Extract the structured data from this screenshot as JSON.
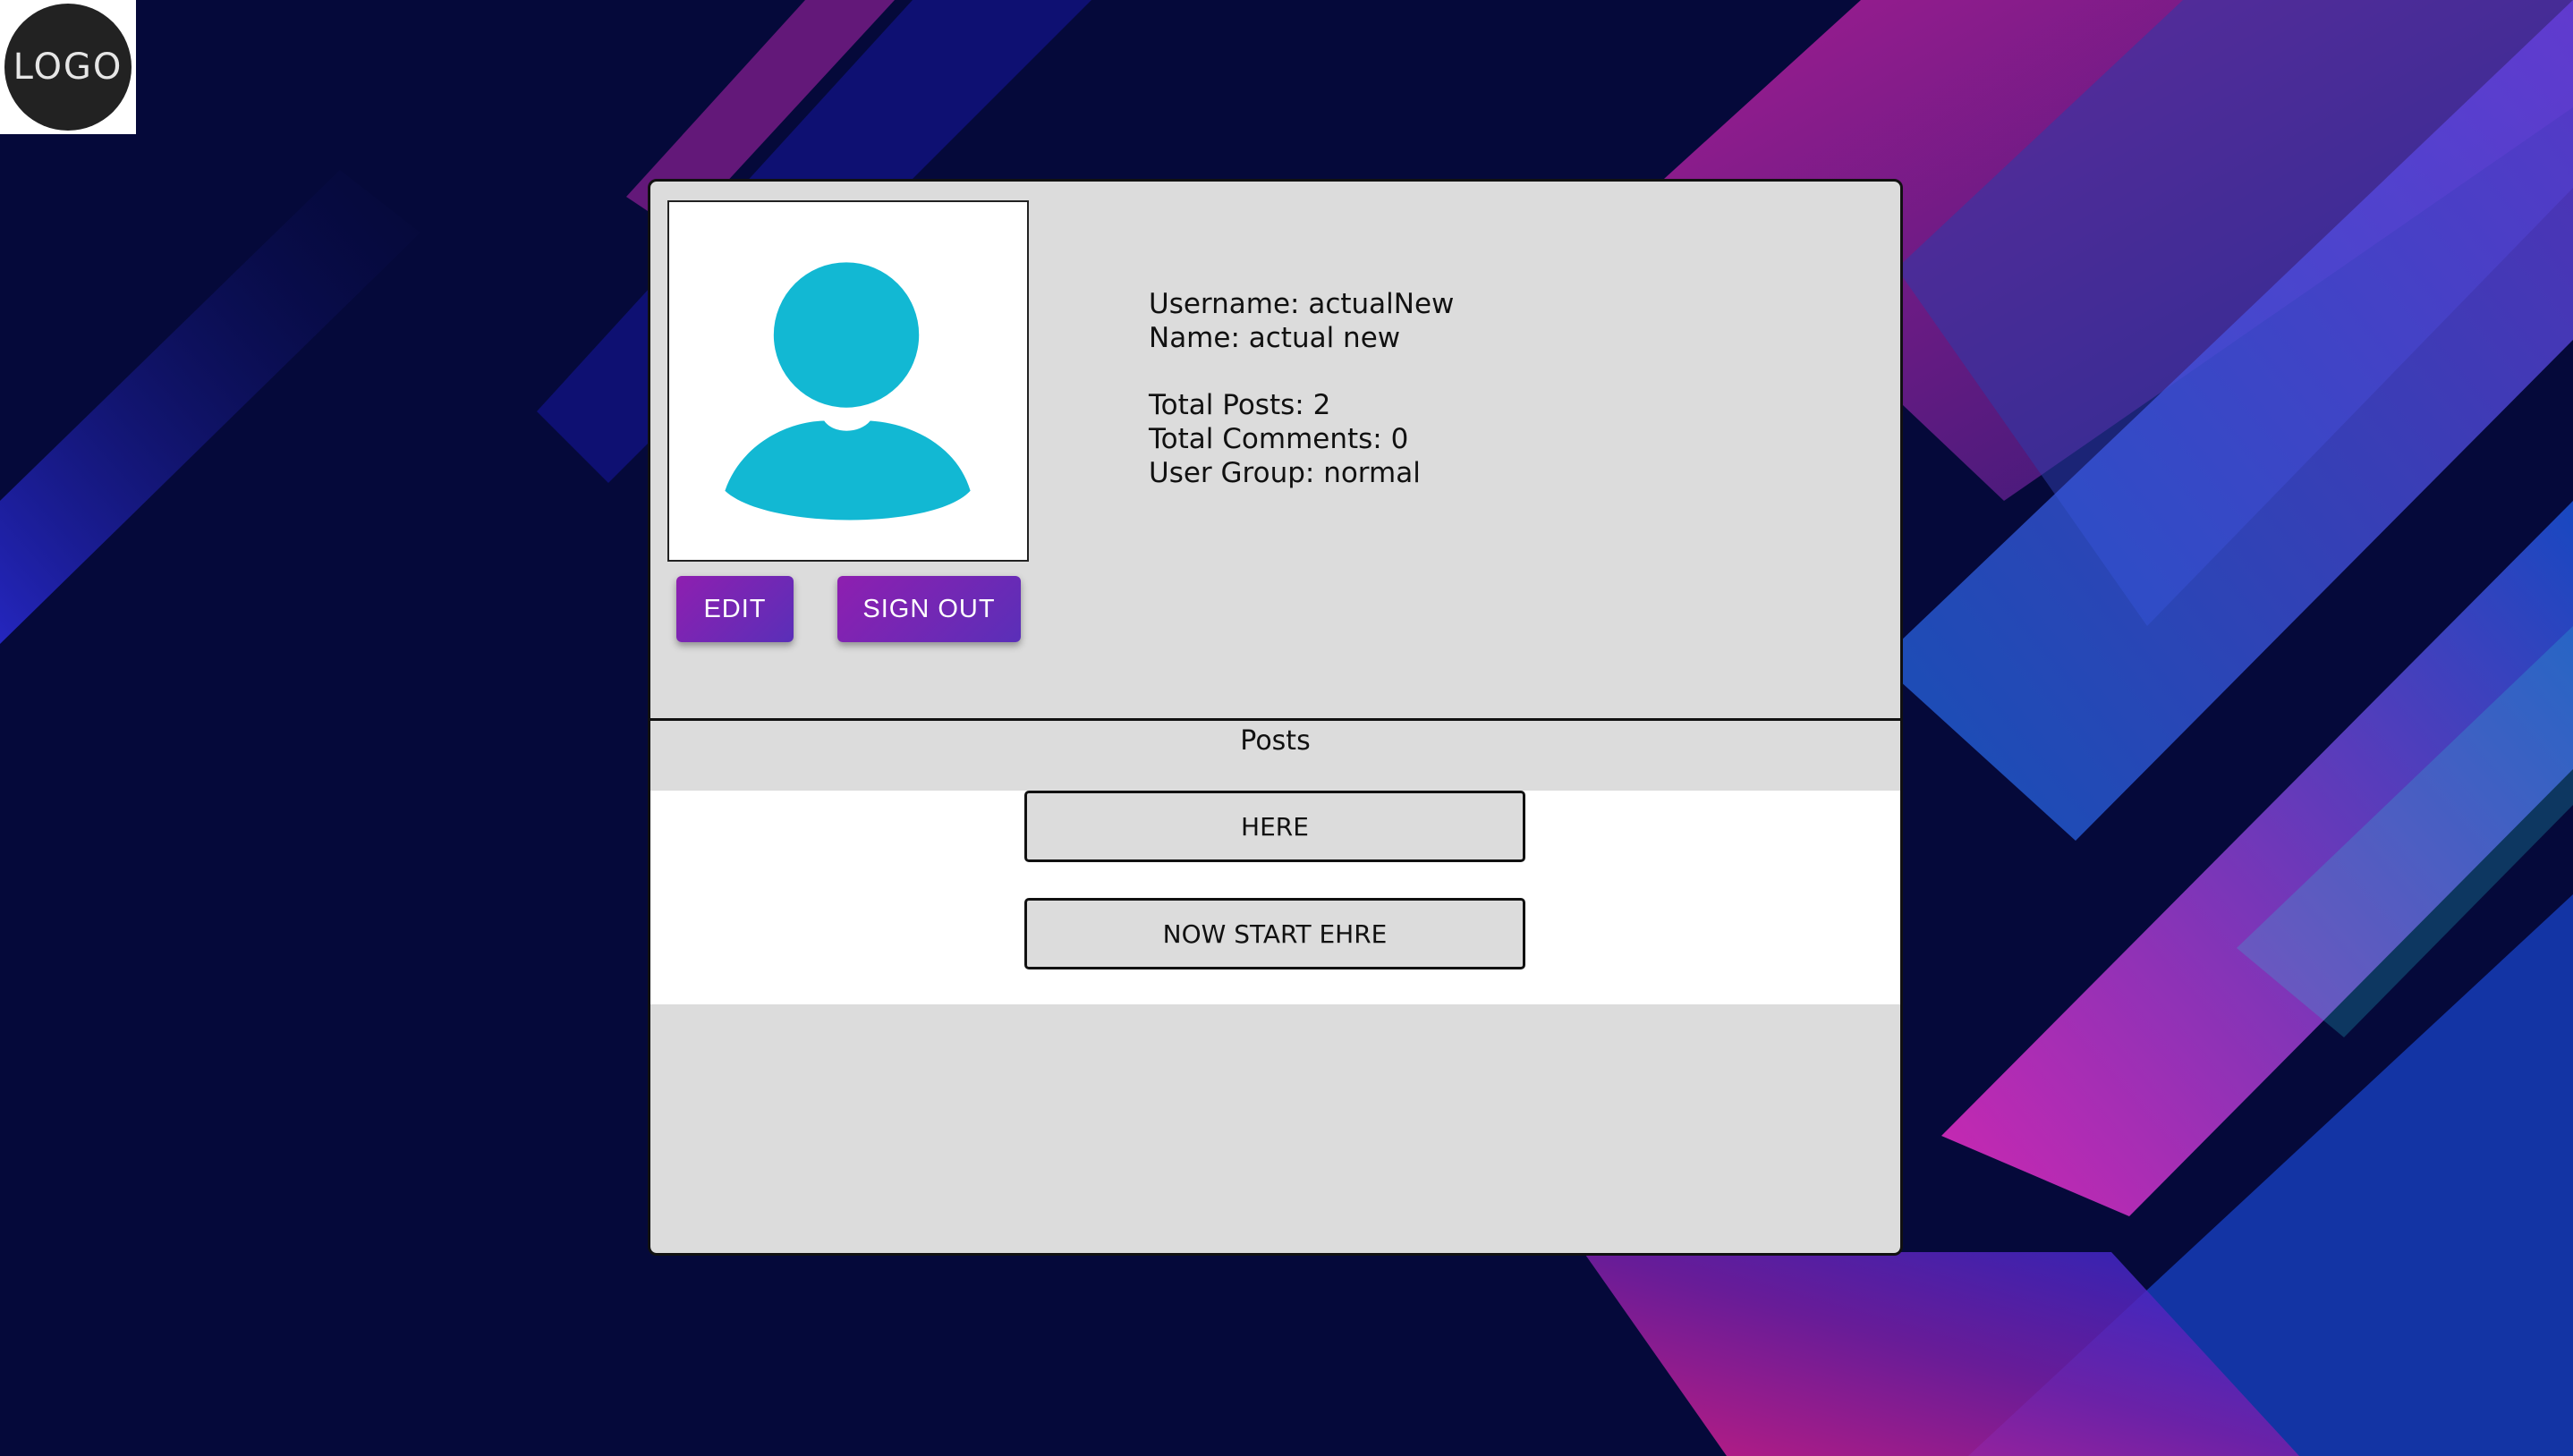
{
  "logo": {
    "text": "LOGO"
  },
  "profile": {
    "avatar_icon": "user-avatar-icon",
    "accent_color": "#12b8d3",
    "buttons": {
      "edit_label": "EDIT",
      "signout_label": "SIGN OUT"
    },
    "info": {
      "username": "Username: actualNew",
      "name": "Name: actual new",
      "total_posts": "Total Posts: 2",
      "total_comments": "Total Comments: 0",
      "user_group": "User Group: normal"
    }
  },
  "posts": {
    "title": "Posts",
    "items": [
      {
        "label": "HERE"
      },
      {
        "label": "NOW START EHRE"
      }
    ]
  }
}
